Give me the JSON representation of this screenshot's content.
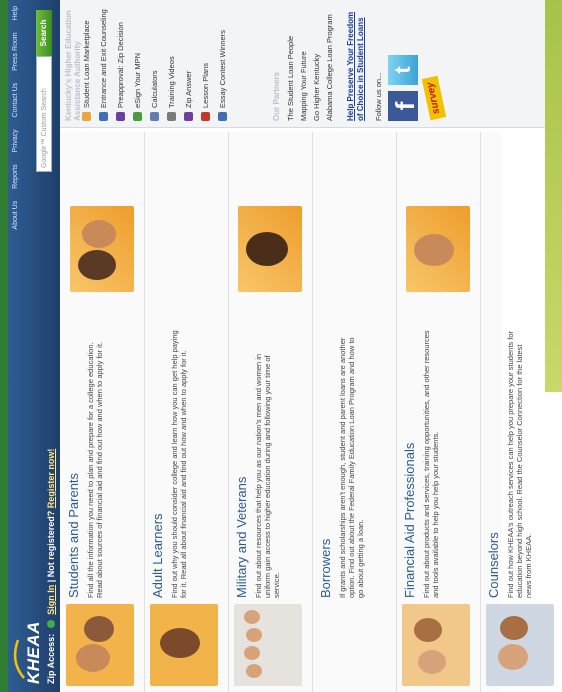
{
  "header": {
    "logo_text": "KHEAA",
    "nav": [
      "About Us",
      "Reports",
      "Privacy",
      "Contact Us",
      "Press Room",
      "Help"
    ],
    "zip_access_label": "Zip Access:",
    "sign_in": "Sign In",
    "separator": "|",
    "not_registered": "Not registered?",
    "register": "Register now!",
    "search_placeholder": "Google™ Custom Search",
    "search_button": "Search"
  },
  "sections": [
    {
      "title": "Students and Parents",
      "description": "Find all the information you need to plan and prepare for a college education. Read about sources of financial aid and find out how and when to apply for it."
    },
    {
      "title": "Adult Learners",
      "description": "Find out why you should consider college and learn how you can get help paying for it. Read all about financial aid and find out how and when to apply for it."
    },
    {
      "title": "Military and Veterans",
      "description": "Find out about resources that help you as our nation's men and women in uniform gain access to higher education during and following your time of service."
    },
    {
      "title": "Borrowers",
      "description": "If grants and scholarships aren't enough, student and parent loans are another option. Find out about the Federal Family Education Loan Program and how to go about getting a loan."
    },
    {
      "title": "Financial Aid Professionals",
      "description": "Find out about products and services, training opportunities, and other resources and tools available to help you help your students."
    },
    {
      "title": "Counselors",
      "description": "Find out how KHEAA's outreach services can help you prepare your students for education beyond high school. Read the Counselor Connection for the latest news from KHEAA."
    }
  ],
  "sidebar": {
    "title": "Kentucky's Higher Education Assistance Authority",
    "tools": [
      {
        "label": "Student Loan Marketplace",
        "icon": "marketplace-icon",
        "color": "#e8a73a"
      },
      {
        "label": "Entrance and Exit Counseling",
        "icon": "counseling-icon",
        "color": "#3f6fb5"
      },
      {
        "label": "Preapproval: Zip Decision",
        "icon": "zip-icon",
        "color": "#6b3f9b"
      },
      {
        "label": "eSign Your MPN",
        "icon": "esign-icon",
        "color": "#4a9b3f"
      },
      {
        "label": "Calculators",
        "icon": "calculator-icon",
        "color": "#5f7fb0"
      },
      {
        "label": "Training Videos",
        "icon": "video-icon",
        "color": "#7a7a7a"
      },
      {
        "label": "Zip Answer",
        "icon": "answer-icon",
        "color": "#6b3f9b"
      },
      {
        "label": "Lesson Plans",
        "icon": "lesson-icon",
        "color": "#c0392b"
      },
      {
        "label": "Essay Contest Winners",
        "icon": "essay-icon",
        "color": "#3f6fb5"
      }
    ],
    "partners_title": "Our Partners",
    "partners": [
      "The Student Loan People",
      "Mapping Your Future",
      "Go Higher Kentucky",
      "Alabama College Loan Program"
    ],
    "freedom_link": "Help Preserve Your Freedom of Choice in Student Loans",
    "follow": "Follow us on...",
    "facebook_letter": "f",
    "twitter_letter": "t",
    "survey": "survey"
  }
}
